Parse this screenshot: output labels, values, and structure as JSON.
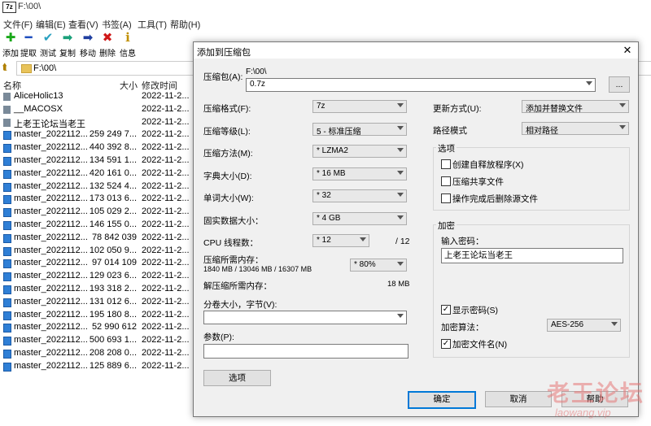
{
  "window": {
    "title": "F:\\00\\",
    "app_icon": "7z"
  },
  "menu": [
    "文件(F)",
    "编辑(E)",
    "查看(V)",
    "书签(A)",
    "工具(T)",
    "帮助(H)"
  ],
  "toolbar": [
    {
      "label": "添加",
      "icon": "plus-icon",
      "color": "#1aa81a",
      "glyph": "✚"
    },
    {
      "label": "提取",
      "icon": "minus-icon",
      "color": "#1f4fbf",
      "glyph": "━"
    },
    {
      "label": "测试",
      "icon": "check-icon",
      "color": "#2aa0c0",
      "glyph": "✔"
    },
    {
      "label": "复制",
      "icon": "copy-arrow-icon",
      "color": "#1aa07a",
      "glyph": "➡"
    },
    {
      "label": "移动",
      "icon": "move-arrow-icon",
      "color": "#1f3fa0",
      "glyph": "➡"
    },
    {
      "label": "删除",
      "icon": "delete-icon",
      "color": "#d01818",
      "glyph": "✖"
    },
    {
      "label": "信息",
      "icon": "info-icon",
      "color": "#c09000",
      "glyph": "ℹ"
    }
  ],
  "address": "F:\\00\\",
  "columns": {
    "name": "名称",
    "size": "大小",
    "modified": "修改时间"
  },
  "files": [
    {
      "type": "folder",
      "name": "AliceHolic13",
      "size": "",
      "date": "2022-11-2..."
    },
    {
      "type": "folder",
      "name": "__MACOSX",
      "size": "",
      "date": "2022-11-2..."
    },
    {
      "type": "folder",
      "name": "上老王论坛当老王",
      "size": "",
      "date": "2022-11-2..."
    },
    {
      "type": "file",
      "name": "master_2022112...",
      "size": "259 249 7...",
      "date": "2022-11-2..."
    },
    {
      "type": "file",
      "name": "master_2022112...",
      "size": "440 392 8...",
      "date": "2022-11-2..."
    },
    {
      "type": "file",
      "name": "master_2022112...",
      "size": "134 591 1...",
      "date": "2022-11-2..."
    },
    {
      "type": "file",
      "name": "master_2022112...",
      "size": "420 161 0...",
      "date": "2022-11-2..."
    },
    {
      "type": "file",
      "name": "master_2022112...",
      "size": "132 524 4...",
      "date": "2022-11-2..."
    },
    {
      "type": "file",
      "name": "master_2022112...",
      "size": "173 013 6...",
      "date": "2022-11-2..."
    },
    {
      "type": "file",
      "name": "master_2022112...",
      "size": "105 029 2...",
      "date": "2022-11-2..."
    },
    {
      "type": "file",
      "name": "master_2022112...",
      "size": "146 155 0...",
      "date": "2022-11-2..."
    },
    {
      "type": "file",
      "name": "master_2022112...",
      "size": "78 842 039",
      "date": "2022-11-2..."
    },
    {
      "type": "file",
      "name": "master_2022112...",
      "size": "102 050 9...",
      "date": "2022-11-2..."
    },
    {
      "type": "file",
      "name": "master_2022112...",
      "size": "97 014 109",
      "date": "2022-11-2..."
    },
    {
      "type": "file",
      "name": "master_2022112...",
      "size": "129 023 6...",
      "date": "2022-11-2..."
    },
    {
      "type": "file",
      "name": "master_2022112...",
      "size": "193 318 2...",
      "date": "2022-11-2..."
    },
    {
      "type": "file",
      "name": "master_2022112...",
      "size": "131 012 6...",
      "date": "2022-11-2..."
    },
    {
      "type": "file",
      "name": "master_2022112...",
      "size": "195 180 8...",
      "date": "2022-11-2..."
    },
    {
      "type": "file",
      "name": "master_2022112...",
      "size": "52 990 612",
      "date": "2022-11-2..."
    },
    {
      "type": "file",
      "name": "master_2022112...",
      "size": "500 693 1...",
      "date": "2022-11-2..."
    },
    {
      "type": "file",
      "name": "master_2022112...",
      "size": "208 208 0...",
      "date": "2022-11-2..."
    },
    {
      "type": "file",
      "name": "master_2022112...",
      "size": "125 889 6...",
      "date": "2022-11-2..."
    }
  ],
  "dialog": {
    "title": "添加到压缩包",
    "archive_label": "压缩包(A):",
    "archive_path": "F:\\00\\",
    "archive_name": "0.7z",
    "browse_label": "...",
    "format_label": "压缩格式(F):",
    "format_value": "7z",
    "level_label": "压缩等级(L):",
    "level_value": "5 - 标准压缩",
    "method_label": "压缩方法(M):",
    "method_value": "* LZMA2",
    "dict_label": "字典大小(D):",
    "dict_value": "* 16 MB",
    "word_label": "单词大小(W):",
    "word_value": "* 32",
    "solid_label": "固实数据大小：",
    "solid_value": "* 4 GB",
    "cpu_label": "CPU 线程数：",
    "cpu_value": "* 12",
    "cpu_max": "/ 12",
    "mem_label": "压缩所需内存：",
    "mem_detail": "1840 MB / 13046 MB / 16307 MB",
    "mem_value": "* 80%",
    "decomp_label": "解压缩所需内存：",
    "decomp_value": "18 MB",
    "split_label": "分卷大小，字节(V):",
    "split_value": "",
    "params_label": "参数(P):",
    "params_value": "",
    "options_button": "选项",
    "update_label": "更新方式(U):",
    "update_value": "添加并替换文件",
    "pathmode_label": "路径模式",
    "pathmode_value": "相对路径",
    "options_group": "选项",
    "opt_sfx": "创建自释放程序(X)",
    "opt_sfx_checked": false,
    "opt_shared": "压缩共享文件",
    "opt_shared_checked": false,
    "opt_delete": "操作完成后删除源文件",
    "opt_delete_checked": false,
    "enc_group": "加密",
    "password_label": "输入密码：",
    "password_value": "上老王论坛当老王",
    "show_pwd": "显示密码(S)",
    "show_pwd_checked": true,
    "enc_method_label": "加密算法：",
    "enc_method_value": "AES-256",
    "enc_names": "加密文件名(N)",
    "enc_names_checked": true,
    "ok": "确定",
    "cancel": "取消",
    "help": "帮助"
  },
  "watermark": {
    "text": "老王论坛",
    "sub": "laowang.vip"
  }
}
